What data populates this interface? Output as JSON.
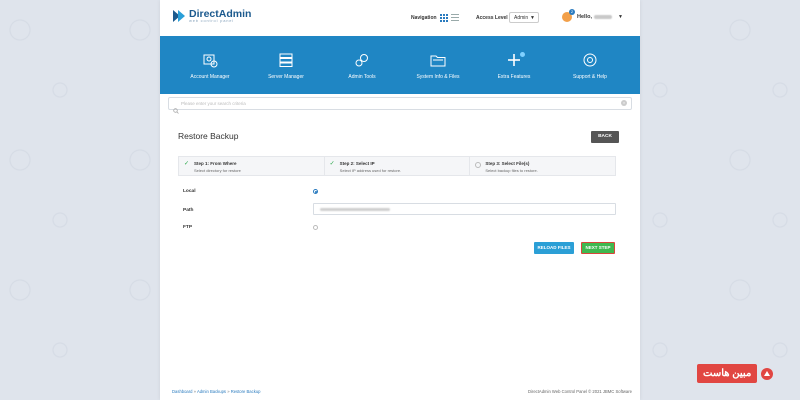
{
  "app": {
    "name": "DirectAdmin",
    "tagline": "web control panel"
  },
  "header": {
    "navigation_label": "Navigation",
    "access_level_label": "Access Level",
    "access_level_value": "Admin",
    "greeting": "Hello,",
    "notification_count": "2"
  },
  "menu": {
    "items": [
      {
        "label": "Account Manager",
        "icon": "account-icon"
      },
      {
        "label": "Server Manager",
        "icon": "server-icon"
      },
      {
        "label": "Admin Tools",
        "icon": "tools-icon"
      },
      {
        "label": "System Info & Files",
        "icon": "folder-icon"
      },
      {
        "label": "Extra Features",
        "icon": "plus-icon"
      },
      {
        "label": "Support & Help",
        "icon": "lifebuoy-icon"
      }
    ]
  },
  "search": {
    "placeholder": "Please enter your search criteria"
  },
  "page": {
    "title": "Restore Backup",
    "back_label": "BACK"
  },
  "steps": [
    {
      "title": "Step 1: From Where",
      "desc": "Select directory for restore",
      "done": true
    },
    {
      "title": "Step 2: Select IP",
      "desc": "Select IP address used for restore.",
      "done": true
    },
    {
      "title": "Step 3: Select File(s)",
      "desc": "Select backup files to restore.",
      "done": false
    }
  ],
  "form": {
    "local_label": "Local",
    "path_label": "Path",
    "ftp_label": "FTP",
    "local_selected": true
  },
  "buttons": {
    "reload": "RELOAD FILES",
    "next": "NEXT STEP"
  },
  "footer": {
    "crumbs": [
      "Dashboard",
      "Admin Backups",
      "Restore Backup"
    ],
    "separator": " » ",
    "copyright": "DirectAdmin Web Control Panel © 2021 JBMC Software"
  },
  "watermark": {
    "text": "مبین هاست"
  },
  "colors": {
    "brand_blue": "#1f86c4",
    "next_green": "#3fb84f",
    "reload_blue": "#2b9fd6",
    "back_dark": "#555555"
  }
}
